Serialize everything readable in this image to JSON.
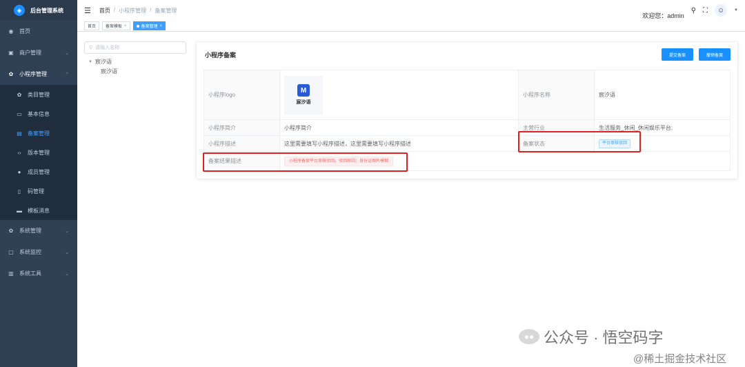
{
  "app": {
    "title": "后台管理系统"
  },
  "sidebar": {
    "items": [
      {
        "label": "首页",
        "icon": "dashboard-icon"
      },
      {
        "label": "商户管理",
        "icon": "shop-icon"
      },
      {
        "label": "小程序管理",
        "icon": "gear-icon"
      },
      {
        "label": "系统管理",
        "icon": "gear-icon"
      },
      {
        "label": "系统监控",
        "icon": "monitor-icon"
      },
      {
        "label": "系统工具",
        "icon": "tool-icon"
      }
    ],
    "submenu": [
      {
        "label": "类目管理"
      },
      {
        "label": "基本信息"
      },
      {
        "label": "备案管理"
      },
      {
        "label": "版本管理"
      },
      {
        "label": "成员管理"
      },
      {
        "label": "码管理"
      },
      {
        "label": "模板消息"
      }
    ]
  },
  "header": {
    "breadcrumb": [
      "首页",
      "/",
      "小程序管理",
      "/",
      "备案管理"
    ],
    "welcome": "欢迎您：admin"
  },
  "tags": [
    {
      "label": "首页"
    },
    {
      "label": "备案模板"
    },
    {
      "label": "备案管理"
    }
  ],
  "tree": {
    "placeholder": "请输入名称",
    "root": "宸汐语",
    "child": "宸汐语"
  },
  "card": {
    "title": "小程序备案",
    "submit_btn": "提交备案",
    "withdraw_btn": "撤销备案",
    "logo_label": "小程序logo",
    "logo_text": "宸汐语",
    "name_label": "小程序名称",
    "name_value": "宸汐语",
    "intro_label": "小程序简介",
    "intro_value": "小程序简介",
    "industry_label": "主营行业",
    "industry_value": "生活服务_休闲_休闲娱乐平台;",
    "desc_label": "小程序描述",
    "desc_value": "这里需要填写小程序描述，这里需要填写小程序描述",
    "status_label": "备案状态",
    "status_value": "平台审核驳回",
    "result_label": "备案结果描述",
    "result_value": "小程序备案平台审核驳回，驳回原因：身份证图片模糊"
  },
  "watermark": {
    "main": "公众号 · 悟空码字",
    "sub": "@稀土掘金技术社区"
  },
  "colors": {
    "sidebar": "#304156",
    "primary": "#1890ff",
    "highlight": "#e02020"
  }
}
